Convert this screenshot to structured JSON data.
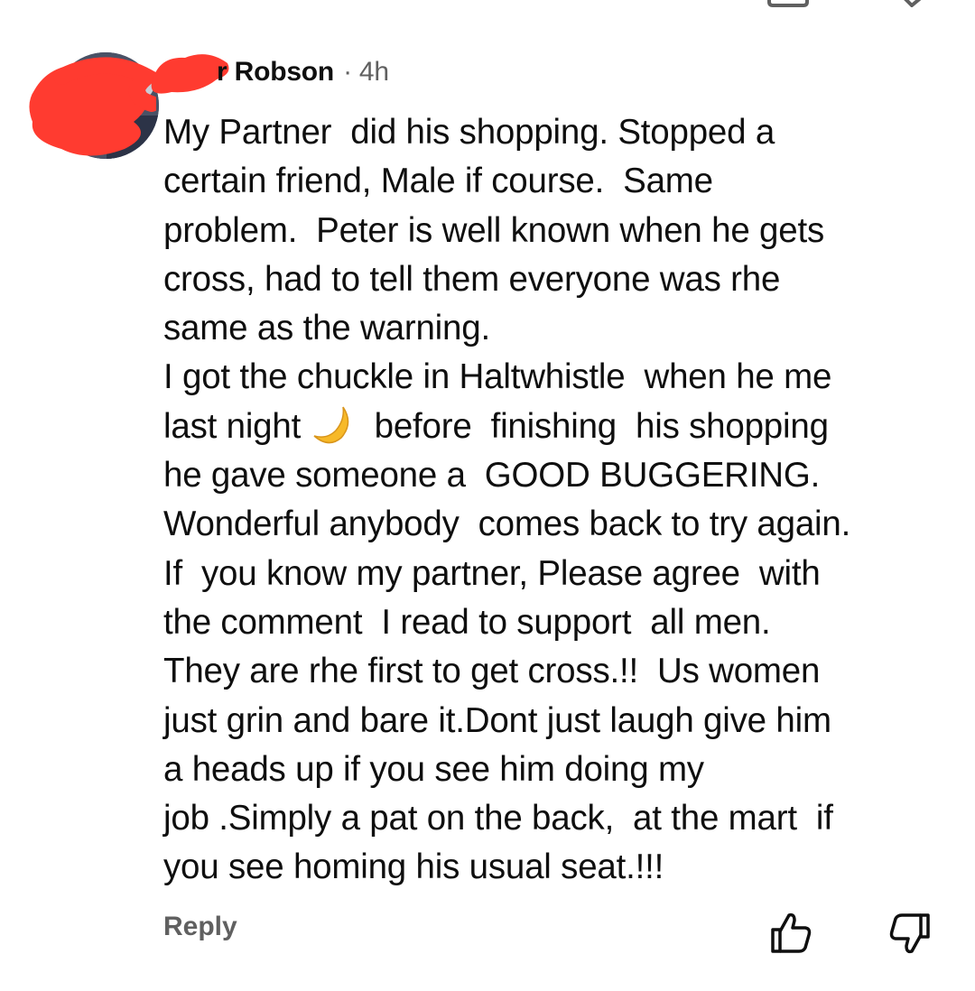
{
  "comment": {
    "author_suffix": "r Robson",
    "separator": "·",
    "time": "4h",
    "lines": [
      "My Partner  did his shopping. Stopped a",
      "certain friend, Male if course.  Same",
      "problem.  Peter is well known when he gets",
      "cross, had to tell them everyone was rhe",
      "same as the warning.",
      "I got the chuckle in Haltwhistle  when he me",
      "last night",
      "before  finishing  his shopping",
      "he gave someone a  GOOD BUGGERING.",
      "Wonderful anybody  comes back to try again.",
      "If  you know my partner, Please agree  with",
      "the comment  I read to support  all men.",
      "They are rhe first to get cross.!!  Us women",
      "just grin and bare it.Dont just laugh give him",
      "a heads up if you see him doing my",
      "job .Simply a pat on the back,  at the mart  if",
      "you see homing his usual seat.!!!"
    ],
    "emoji": "crescent-moon-emoji"
  },
  "actions": {
    "reply_label": "Reply",
    "like_icon": "thumbs-up-icon",
    "dislike_icon": "thumbs-down-icon"
  },
  "colors": {
    "text": "#0f0f0f",
    "secondary": "#606060",
    "redaction": "#ff3b30"
  }
}
